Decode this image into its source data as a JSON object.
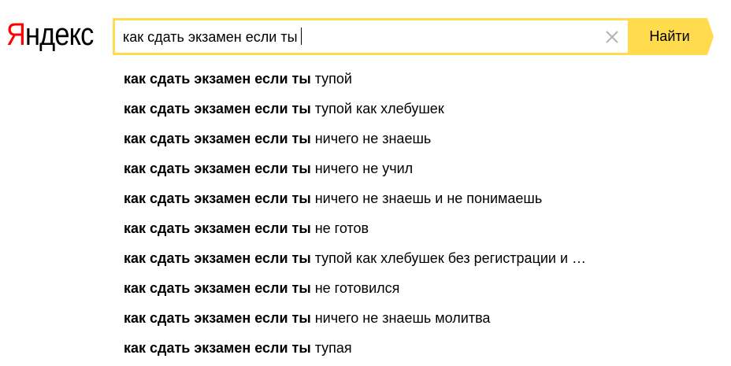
{
  "logo": {
    "first_letter": "Я",
    "rest": "ндекс"
  },
  "search": {
    "query": "как сдать экзамен если ты",
    "button_label": "Найти"
  },
  "suggestions": [
    {
      "bold": "как сдать экзамен если ты",
      "rest": "тупой"
    },
    {
      "bold": "как сдать экзамен если ты",
      "rest": "тупой как хлебушек"
    },
    {
      "bold": "как сдать экзамен если ты",
      "rest": "ничего не знаешь"
    },
    {
      "bold": "как сдать экзамен если ты",
      "rest": "ничего не учил"
    },
    {
      "bold": "как сдать экзамен если ты",
      "rest": "ничего не знаешь и не понимаешь"
    },
    {
      "bold": "как сдать экзамен если ты",
      "rest": "не готов"
    },
    {
      "bold": "как сдать экзамен если ты",
      "rest": "тупой как хлебушек без регистрации и …"
    },
    {
      "bold": "как сдать экзамен если ты",
      "rest": "не готовился"
    },
    {
      "bold": "как сдать экзамен если ты",
      "rest": "ничего не знаешь молитва"
    },
    {
      "bold": "как сдать экзамен если ты",
      "rest": "тупая"
    }
  ],
  "colors": {
    "logo_accent": "#ff0000",
    "search_border": "#ffdb4d",
    "button_bg": "#ffdb4d"
  },
  "icons": {
    "clear": "close-icon"
  }
}
